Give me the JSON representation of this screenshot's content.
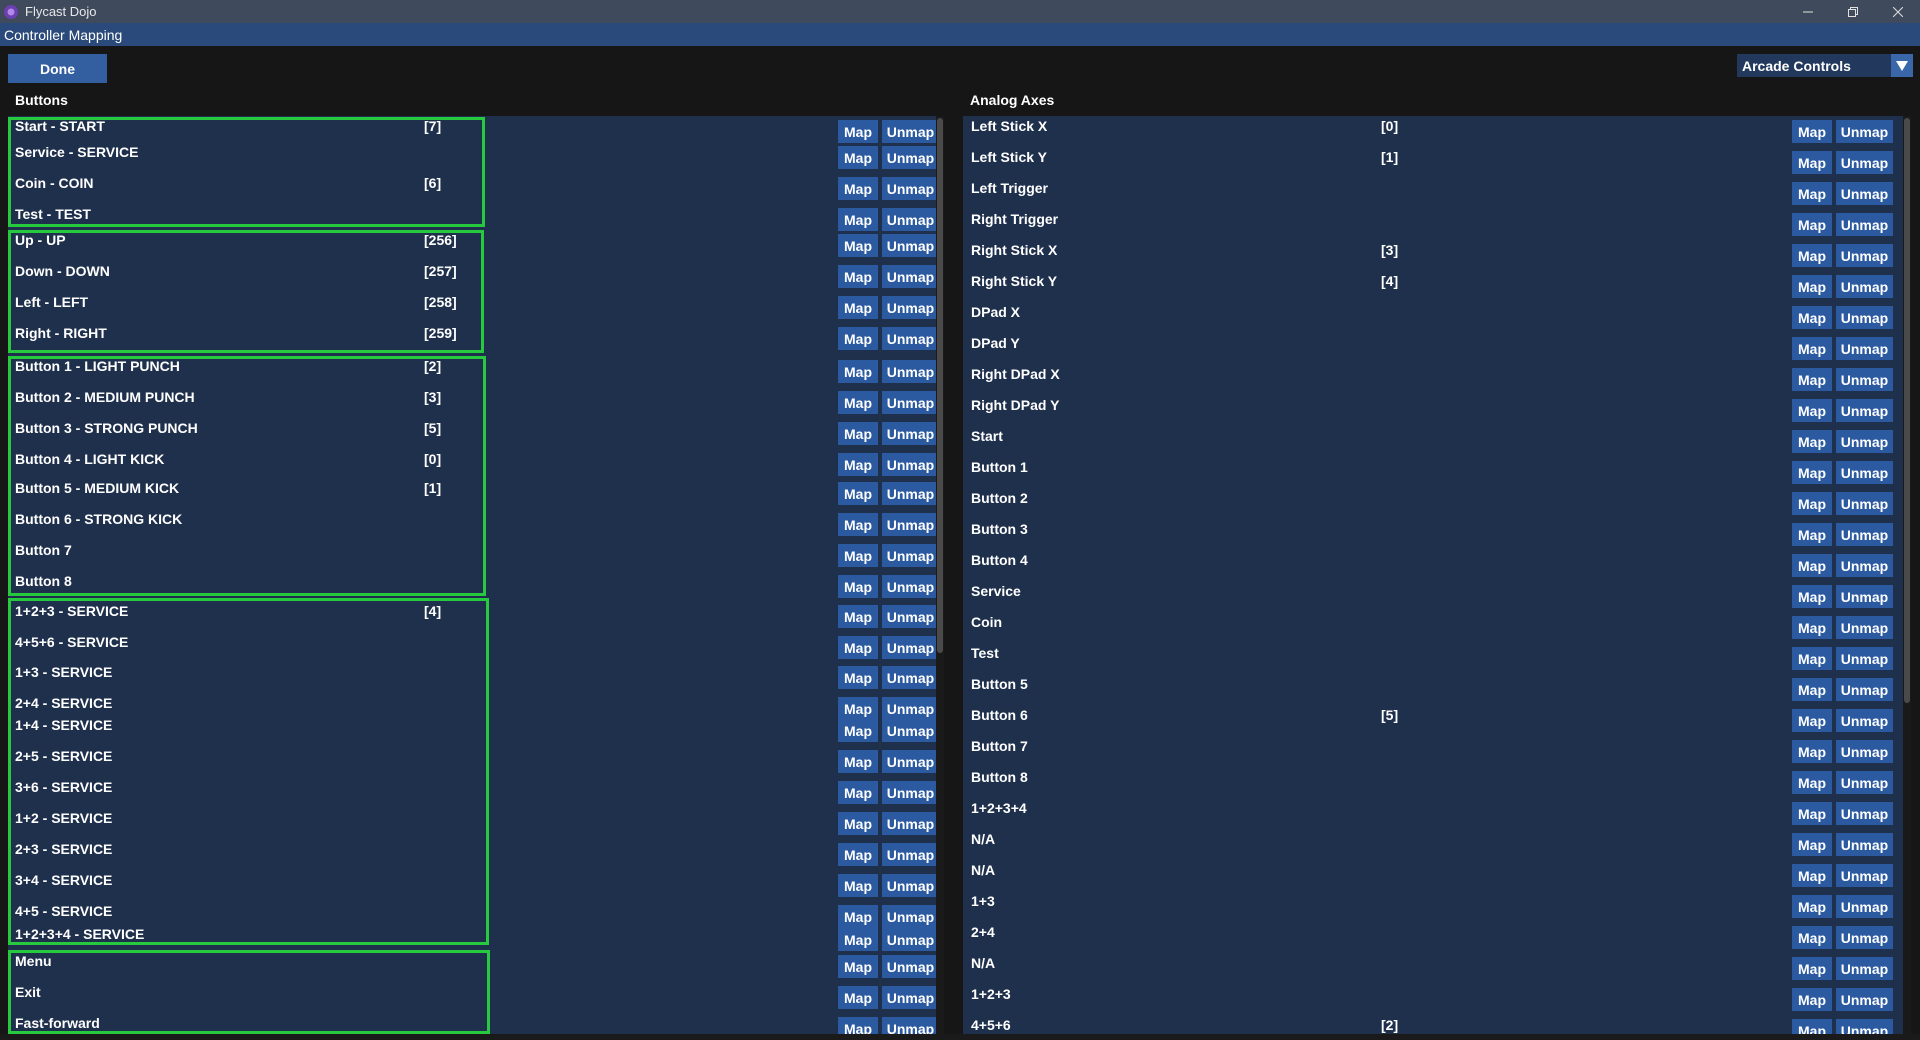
{
  "window": {
    "title": "Flycast Dojo",
    "icon": "flycast-logo-icon",
    "controls": [
      "minimize-icon",
      "restore-icon",
      "close-icon"
    ]
  },
  "menubar": {
    "title": "Controller Mapping"
  },
  "toolbar": {
    "done_label": "Done",
    "mapping_mode": "Arcade Controls",
    "dropdown_icon": "triangle-down-icon"
  },
  "buttons_section": {
    "title": "Buttons",
    "map_label": "Map",
    "unmap_label": "Unmap",
    "items": [
      {
        "name": "Start - START",
        "code": "[7]"
      },
      {
        "name": "Service - SERVICE",
        "code": ""
      },
      {
        "name": "Coin - COIN",
        "code": "[6]"
      },
      {
        "name": "Test - TEST",
        "code": ""
      },
      {
        "name": "Up - UP",
        "code": "[256]"
      },
      {
        "name": "Down - DOWN",
        "code": "[257]"
      },
      {
        "name": "Left - LEFT",
        "code": "[258]"
      },
      {
        "name": "Right - RIGHT",
        "code": "[259]"
      },
      {
        "name": "Button 1 - LIGHT PUNCH",
        "code": "[2]"
      },
      {
        "name": "Button 2 - MEDIUM PUNCH",
        "code": "[3]"
      },
      {
        "name": "Button 3 - STRONG PUNCH",
        "code": "[5]"
      },
      {
        "name": "Button 4 - LIGHT KICK",
        "code": "[0]"
      },
      {
        "name": "Button 5 - MEDIUM KICK",
        "code": "[1]"
      },
      {
        "name": "Button 6 - STRONG KICK",
        "code": ""
      },
      {
        "name": "Button 7",
        "code": ""
      },
      {
        "name": "Button 8",
        "code": ""
      },
      {
        "name": "1+2+3 - SERVICE",
        "code": "[4]"
      },
      {
        "name": "4+5+6 - SERVICE",
        "code": ""
      },
      {
        "name": "1+3 - SERVICE",
        "code": ""
      },
      {
        "name": "2+4 - SERVICE",
        "code": ""
      },
      {
        "name": "1+4 - SERVICE",
        "code": ""
      },
      {
        "name": "2+5 - SERVICE",
        "code": ""
      },
      {
        "name": "3+6 - SERVICE",
        "code": ""
      },
      {
        "name": "1+2 - SERVICE",
        "code": ""
      },
      {
        "name": "2+3 - SERVICE",
        "code": ""
      },
      {
        "name": "3+4 - SERVICE",
        "code": ""
      },
      {
        "name": "4+5 - SERVICE",
        "code": ""
      },
      {
        "name": "1+2+3+4 - SERVICE",
        "code": ""
      },
      {
        "name": "Menu",
        "code": ""
      },
      {
        "name": "Exit",
        "code": ""
      },
      {
        "name": "Fast-forward",
        "code": ""
      }
    ]
  },
  "axes_section": {
    "title": "Analog Axes",
    "map_label": "Map",
    "unmap_label": "Unmap",
    "items": [
      {
        "name": "Left Stick X",
        "code": "[0]"
      },
      {
        "name": "Left Stick Y",
        "code": "[1]"
      },
      {
        "name": "Left Trigger",
        "code": ""
      },
      {
        "name": "Right Trigger",
        "code": ""
      },
      {
        "name": "Right Stick X",
        "code": "[3]"
      },
      {
        "name": "Right Stick Y",
        "code": "[4]"
      },
      {
        "name": "DPad X",
        "code": ""
      },
      {
        "name": "DPad Y",
        "code": ""
      },
      {
        "name": "Right DPad X",
        "code": ""
      },
      {
        "name": "Right DPad Y",
        "code": ""
      },
      {
        "name": "Start",
        "code": ""
      },
      {
        "name": "Button 1",
        "code": ""
      },
      {
        "name": "Button 2",
        "code": ""
      },
      {
        "name": "Button 3",
        "code": ""
      },
      {
        "name": "Button 4",
        "code": ""
      },
      {
        "name": "Service",
        "code": ""
      },
      {
        "name": "Coin",
        "code": ""
      },
      {
        "name": "Test",
        "code": ""
      },
      {
        "name": "Button 5",
        "code": ""
      },
      {
        "name": "Button 6",
        "code": "[5]"
      },
      {
        "name": "Button 7",
        "code": ""
      },
      {
        "name": "Button 8",
        "code": ""
      },
      {
        "name": "1+2+3+4",
        "code": ""
      },
      {
        "name": "N/A",
        "code": ""
      },
      {
        "name": "N/A",
        "code": ""
      },
      {
        "name": "1+3",
        "code": ""
      },
      {
        "name": "2+4",
        "code": ""
      },
      {
        "name": "N/A",
        "code": ""
      },
      {
        "name": "1+2+3",
        "code": ""
      },
      {
        "name": "4+5+6",
        "code": "[2]"
      }
    ]
  },
  "colors": {
    "highlight_border": "#27c93f",
    "panel_bg": "#1f304d",
    "button_bg": "#2b5aa0",
    "title_bar": "#3f4b5d",
    "menu_bar": "#294a7a"
  }
}
